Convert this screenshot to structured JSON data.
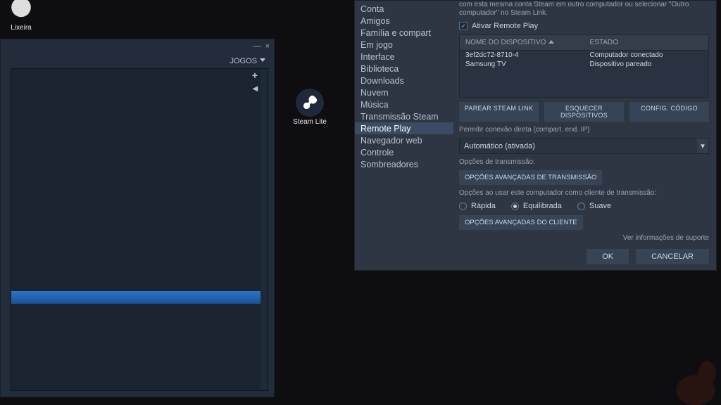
{
  "desktop": {
    "recycle_label": "Lixeira",
    "steamlite_label": "Steam Lite"
  },
  "left_window": {
    "minimize": "—",
    "close": "×",
    "jogos_label": "JOGOS",
    "plus": "+",
    "caret": "◂"
  },
  "settings": {
    "nav": {
      "conta": "Conta",
      "amigos": "Amigos",
      "familia": "Família e compart",
      "emjogo": "Em jogo",
      "interface": "Interface",
      "biblioteca": "Biblioteca",
      "downloads": "Downloads",
      "nuvem": "Nuvem",
      "musica": "Música",
      "transmissao": "Transmissão Steam",
      "remoteplay": "Remote Play",
      "navegador": "Navegador web",
      "controle": "Controle",
      "sombreadores": "Sombreadores"
    },
    "description": "com esta mesma conta Steam em outro computador ou selecionar \"Outro computador\" no Steam Link.",
    "enable_label": "Ativar Remote Play",
    "table": {
      "col_device": "NOME DO DISPOSITIVO",
      "col_state": "ESTADO",
      "row1_device": "3ef2dc72-8710-4",
      "row1_state": "Computador conectado",
      "row2_device": "Samsung TV",
      "row2_state": "Dispositivo pareado"
    },
    "btns": {
      "pair": "PAREAR STEAM LINK",
      "unpair": "ESQUECER DISPOSITIVOS",
      "code": "CONFIG. CÓDIGO"
    },
    "direct_label": "Permitir conexão direta (compart. end. IP)",
    "direct_value": "Automático (ativada)",
    "host_opts_label": "Opções de transmissão:",
    "host_adv_btn": "OPÇÕES AVANÇADAS DE TRANSMISSÃO",
    "client_label": "Opções ao usar este computador como cliente de transmissão:",
    "radios": {
      "fast": "Rápida",
      "balanced": "Equilibrada",
      "smooth": "Suave"
    },
    "client_adv_btn": "OPÇÕES AVANÇADAS DO CLIENTE",
    "support": "Ver informações de suporte",
    "ok": "OK",
    "cancel": "CANCELAR"
  }
}
